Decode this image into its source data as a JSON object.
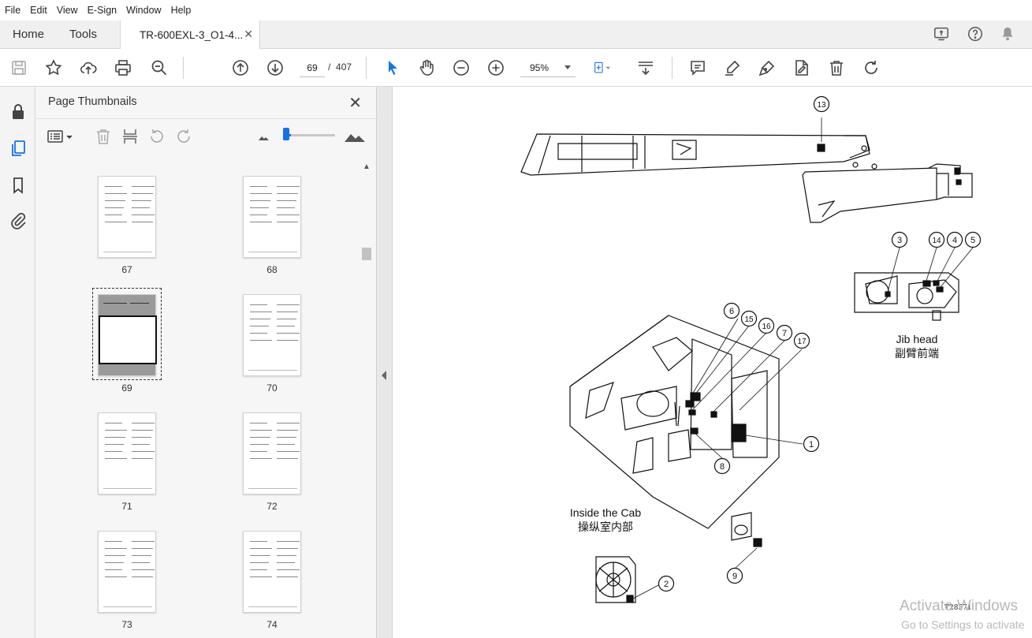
{
  "menu": [
    "File",
    "Edit",
    "View",
    "E-Sign",
    "Window",
    "Help"
  ],
  "tabs": {
    "home": "Home",
    "tools": "Tools",
    "document": "TR-600EXL-3_O1-4...",
    "close": "✕"
  },
  "toolbar": {
    "page_current": "69",
    "page_separator": "/",
    "page_total": "407",
    "zoom": "95%"
  },
  "panel": {
    "title": "Page Thumbnails",
    "close": "✕"
  },
  "thumbnails": [
    {
      "label": "67"
    },
    {
      "label": "68"
    },
    {
      "label": "69",
      "selected": true
    },
    {
      "label": "70"
    },
    {
      "label": "71"
    },
    {
      "label": "72"
    },
    {
      "label": "73"
    },
    {
      "label": "74"
    }
  ],
  "diagram": {
    "callouts": [
      "13",
      "3",
      "14",
      "4",
      "5",
      "6",
      "15",
      "16",
      "7",
      "17",
      "1",
      "8",
      "2",
      "9"
    ],
    "jib_head_en": "Jib head",
    "jib_head_cn": "副臂前端",
    "cab_en": "Inside the Cab",
    "cab_cn": "操纵室内部",
    "figure_id": "T28571"
  },
  "watermark": {
    "line1": "Activate Windows",
    "line2": "Go to Settings to activate"
  },
  "colors": {
    "accent": "#1473e6",
    "selection": "#333333"
  }
}
